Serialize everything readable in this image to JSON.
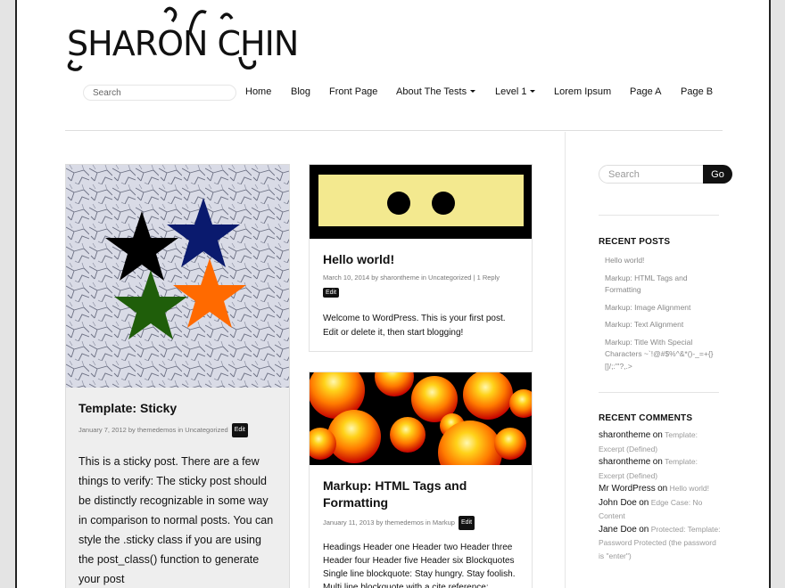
{
  "site": {
    "title": "SHARON CHIN"
  },
  "header": {
    "search_placeholder": "Search",
    "nav": [
      {
        "label": "Home"
      },
      {
        "label": "Blog"
      },
      {
        "label": "Front Page"
      },
      {
        "label": "About The Tests",
        "dropdown": true
      },
      {
        "label": "Level 1",
        "dropdown": true
      },
      {
        "label": "Lorem Ipsum"
      },
      {
        "label": "Page A"
      },
      {
        "label": "Page B"
      }
    ]
  },
  "posts": [
    {
      "title": "Template: Sticky",
      "date": "January 7, 2012",
      "by": "by",
      "author": "themedemos",
      "in": "in",
      "category": "Uncategorized",
      "edit": "Edit",
      "excerpt": "This is a sticky post. There are a few things to verify: The sticky post should be distinctly recognizable in some way in comparison to normal posts. You can style the .sticky class if you are using the post_class() function to generate your post"
    },
    {
      "title": "Hello world!",
      "date": "March 10, 2014",
      "by": "by",
      "author": "sharontheme",
      "in": "in",
      "category": "Uncategorized",
      "sep": "|",
      "replies": "1 Reply",
      "edit": "Edit",
      "excerpt": "Welcome to WordPress. This is your first post. Edit or delete it, then start blogging!"
    },
    {
      "title": "Markup: HTML Tags and Formatting",
      "date": "January 11, 2013",
      "by": "by",
      "author": "themedemos",
      "in": "in",
      "category": "Markup",
      "edit": "Edit",
      "excerpt": "Headings Header one Header two Header three Header four Header five Header six Blockquotes Single line blockquote: Stay hungry. Stay foolish. Multi line blockquote with a cite reference: People think focus"
    }
  ],
  "sidebar": {
    "search_placeholder": "Search",
    "go_label": "Go",
    "recent_posts_title": "RECENT POSTS",
    "recent_posts": [
      "Hello world!",
      "Markup: HTML Tags and Formatting",
      "Markup: Image Alignment",
      "Markup: Text Alignment",
      "Markup: Title With Special Characters ~`!@#$%^&*()-_=+{}[]/;:'\"?,.>"
    ],
    "recent_comments_title": "RECENT COMMENTS",
    "recent_comments": [
      {
        "author": "sharontheme",
        "on": "on",
        "post": "Template: Excerpt (Defined)"
      },
      {
        "author": "sharontheme",
        "on": "on",
        "post": "Template: Excerpt (Defined)"
      },
      {
        "author": "Mr WordPress",
        "on": "on",
        "post": "Hello world!"
      },
      {
        "author": "John Doe",
        "on": "on",
        "post": "Edge Case: No Content"
      },
      {
        "author": "Jane Doe",
        "on": "on",
        "post": "Protected: Template: Password Protected (the password is \"enter\")"
      }
    ]
  },
  "colors": {
    "star_black": "#000000",
    "star_navy": "#0a1a6e",
    "star_green": "#1f5e0a",
    "star_orange": "#ff6a00",
    "banner_yellow": "#f3e98f",
    "accent_dark": "#111111"
  }
}
